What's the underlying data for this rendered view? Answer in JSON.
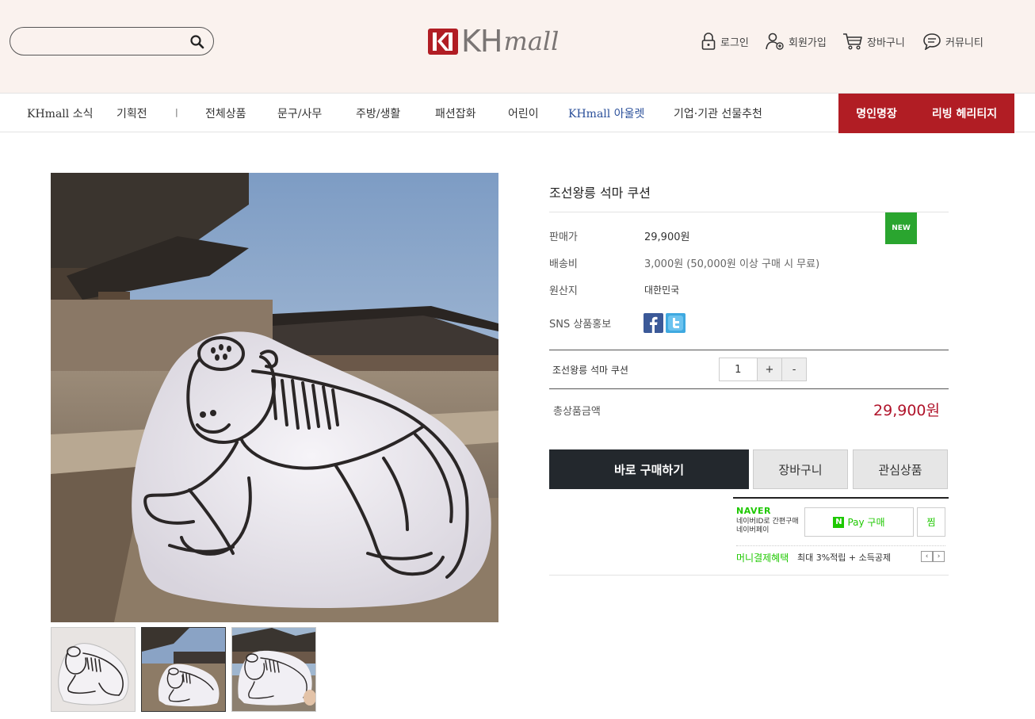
{
  "header": {
    "search_placeholder": "",
    "logo_text_kh": "KH",
    "logo_text_mall": "mall",
    "util": [
      {
        "label": "로그인",
        "icon": "lock-icon"
      },
      {
        "label": "회원가입",
        "icon": "user-add-icon"
      },
      {
        "label": "장바구니",
        "icon": "cart-icon"
      },
      {
        "label": "커뮤니티",
        "icon": "chat-icon"
      }
    ]
  },
  "nav": {
    "items": [
      "KHmall 소식",
      "기획전",
      "전체상품",
      "문구/사무",
      "주방/생활",
      "패션잡화",
      "어린이",
      "KHmall 아울렛",
      "기업·기관 선물추천"
    ],
    "separator": "|",
    "red_items": [
      "명인명장",
      "리빙 헤리티지"
    ]
  },
  "product": {
    "title": "조선왕릉 석마 쿠션",
    "new_badge": "NEW",
    "rows": [
      {
        "label": "판매가",
        "value": "29,900원"
      },
      {
        "label": "배송비",
        "value": "3,000원 (50,000원 이상 구매 시 무료)"
      },
      {
        "label": "원산지",
        "value": "대한민국"
      },
      {
        "label": "SNS 상품홍보",
        "value": ""
      }
    ],
    "option_name": "조선왕릉 석마 쿠션",
    "quantity": "1",
    "qty_plus": "+",
    "qty_minus": "-",
    "total_label": "총상품금액",
    "total_value": "29,900원",
    "buttons": {
      "buy": "바로 구매하기",
      "cart": "장바구니",
      "wish": "관심상품"
    }
  },
  "naver": {
    "logo": "NAVER",
    "sub1": "네이버ID로 간편구매",
    "sub2": "네이버페이",
    "pay_label": "Pay 구매",
    "pay_n": "N",
    "zzim": "찜",
    "benefit_label": "머니결제혜택",
    "benefit_desc": "최대 3%적립 + 소득공제",
    "prev": "‹",
    "next": "›"
  },
  "colors": {
    "header_bg": "#faf2ee",
    "brand_red": "#b11d24",
    "buy_btn": "#23282d",
    "price_red": "#b0132a",
    "naver_green": "#1ec800",
    "new_green": "#2aa52f"
  }
}
